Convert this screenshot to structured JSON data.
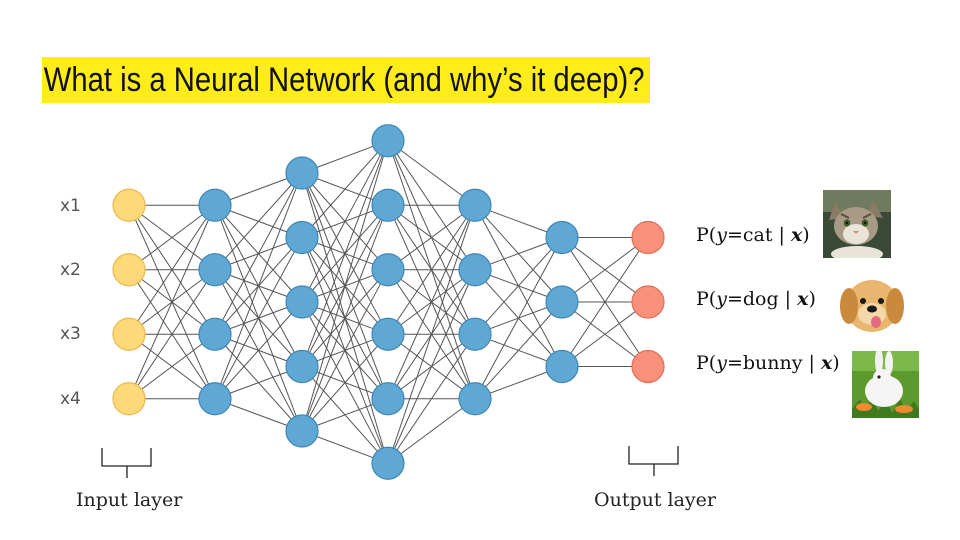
{
  "title": "What is a Neural Network (and why’s it deep)?",
  "input_labels": [
    "x1",
    "x2",
    "x3",
    "x4"
  ],
  "outputs": [
    {
      "prefix": "P(",
      "y": "y",
      "eq": "=",
      "cls": "cat",
      "bar": " | ",
      "x": "x",
      "close": ")"
    },
    {
      "prefix": "P(",
      "y": "y",
      "eq": "=",
      "cls": "dog",
      "bar": " | ",
      "x": "x",
      "close": ")"
    },
    {
      "prefix": "P(",
      "y": "y",
      "eq": "=",
      "cls": "bunny",
      "bar": " | ",
      "x": "x",
      "close": ")"
    }
  ],
  "input_layer_label": "Input layer",
  "output_layer_label": "Output layer",
  "network": {
    "layer_sizes": [
      4,
      4,
      5,
      6,
      4,
      3,
      3
    ],
    "colors": {
      "input": "#fdd97a",
      "input_stroke": "#e9b94a",
      "hidden": "#5fa8d3",
      "hidden_stroke": "#3f88b6",
      "output": "#f9907a",
      "output_stroke": "#e06d57",
      "edge": "#555555"
    }
  },
  "thumbnails": [
    "cat-photo",
    "dog-photo",
    "bunny-photo"
  ]
}
